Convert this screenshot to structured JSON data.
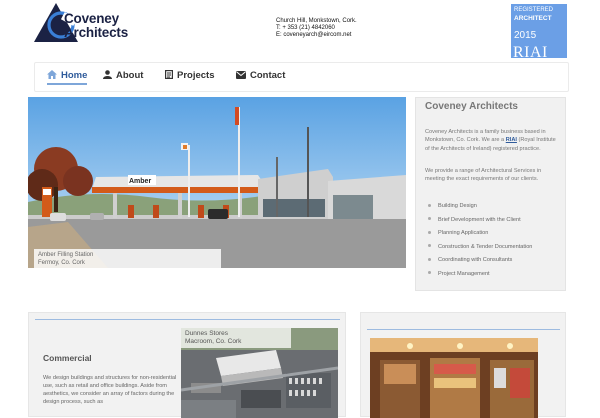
{
  "header": {
    "logo_line1": "Coveney",
    "logo_line2": "Architects",
    "address": "Church Hill, Monkstown, Cork.",
    "phone": "T: + 353 (21) 4842060",
    "email": "E: coveneyarch@eircom.net"
  },
  "badge": {
    "line1": "REGISTERED",
    "line2": "ARCHITECT",
    "year": "2015",
    "org": "RIAI"
  },
  "nav": {
    "items": [
      {
        "label": "Home",
        "icon": "home-icon",
        "active": true
      },
      {
        "label": "About",
        "icon": "user-icon",
        "active": false
      },
      {
        "label": "Projects",
        "icon": "document-icon",
        "active": false
      },
      {
        "label": "Contact",
        "icon": "envelope-icon",
        "active": false
      }
    ]
  },
  "hero": {
    "caption_line1": "Amber Filling Station",
    "caption_line2": "Fermoy, Co. Cork",
    "sign_text": "Amber"
  },
  "sidebar": {
    "title": "Coveney Architects",
    "intro_before": "Coveney Architects is a family business based in Monkstown, Co. Cork. We are a",
    "intro_link": "RIAI",
    "intro_after": "(Royal Institute of the Architects of Ireland) registered practice.",
    "services_intro": "We provide a range of Architectural Services in meeting the exact requirements of our clients.",
    "services": [
      "Building Design",
      "Brief Development with the Client",
      "Planning Application",
      "Construction & Tender Documentation",
      "Coordinating with Consultants",
      "Project Management"
    ]
  },
  "commercial": {
    "title": "Commercial",
    "text": "We design buildings and structures for non-residential use, such as retail and office buildings. Aside from aesthetics, we consider an array of factors during the design process, such as",
    "thumb_caption_line1": "Dunnes Stores",
    "thumb_caption_line2": "Macroom, Co. Cork"
  },
  "colors": {
    "accent": "#2f5b9b",
    "badge": "#6b9fe6"
  }
}
